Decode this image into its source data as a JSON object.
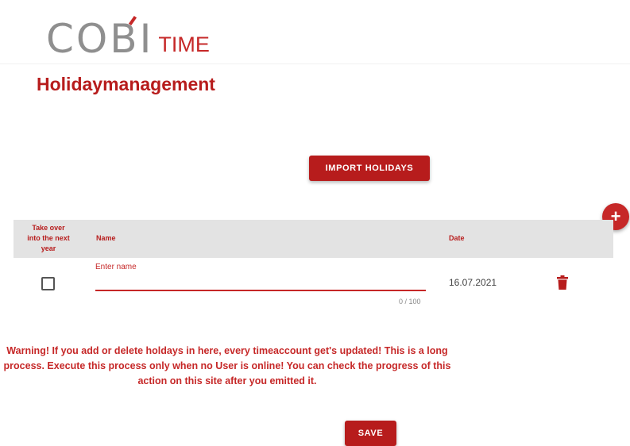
{
  "logo": {
    "main": "COBI",
    "suffix": "TIME"
  },
  "page": {
    "title": "Holidaymanagement"
  },
  "actions": {
    "import_label": "IMPORT HOLIDAYS",
    "add_icon": "+",
    "save_label": "SAVE"
  },
  "table": {
    "columns": {
      "carry_over": "Take over into the next year",
      "name": "Name",
      "date": "Date"
    },
    "rows": [
      {
        "carry_over": false,
        "name_label": "Enter name",
        "name_value": "",
        "char_counter": "0 / 100",
        "date": "16.07.2021",
        "delete_icon": "trash-icon"
      }
    ]
  },
  "warning": "Warning! If you add or delete holdays in here, every timeaccount get's updated! This is a long process. Execute this process only when no User is online! You can check the progress of this action on this site after you emitted it.",
  "colors": {
    "primary": "#b71c1c",
    "accent": "#c62828",
    "logo_gray": "#8f8f8f",
    "header_row": "#e3e3e3"
  }
}
